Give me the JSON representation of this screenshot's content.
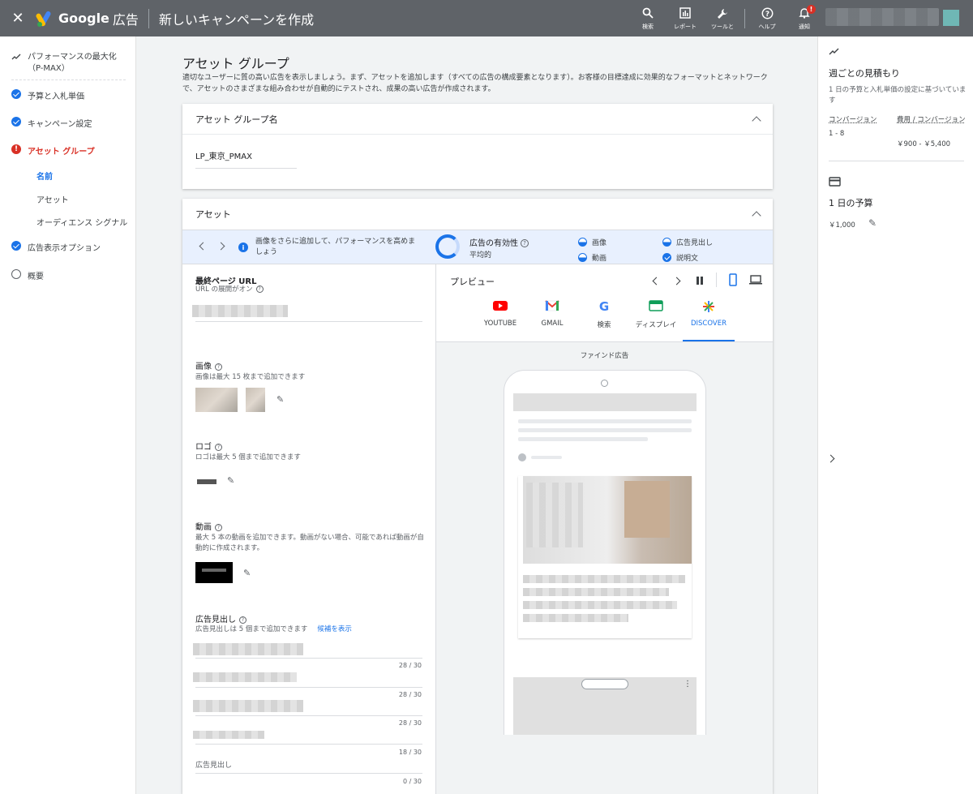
{
  "topbar": {
    "brand_google": "Google",
    "brand_product": "広告",
    "title": "新しいキャンペーンを作成",
    "actions": [
      {
        "label": "検索",
        "icon": "search-icon"
      },
      {
        "label": "レポート",
        "icon": "reports-icon"
      },
      {
        "label": "ツールと設定",
        "icon": "wrench-icon"
      },
      {
        "label": "ヘルプ",
        "icon": "help-icon"
      },
      {
        "label": "通知",
        "icon": "bell-icon"
      }
    ],
    "notification_count": "!"
  },
  "leftnav": {
    "items": [
      {
        "label": "パフォーマンスの最大化（P-MAX）",
        "status": "trend"
      },
      {
        "label": "予算と入札単価",
        "status": "done"
      },
      {
        "label": "キャンペーン設定",
        "status": "done"
      },
      {
        "label": "アセット グループ",
        "status": "error"
      },
      {
        "label": "広告表示オプション",
        "status": "done"
      },
      {
        "label": "概要",
        "status": "empty"
      }
    ],
    "subitems": [
      "名前",
      "アセット",
      "オーディエンス シグナル"
    ]
  },
  "main": {
    "title": "アセット グループ",
    "description": "適切なユーザーに質の高い広告を表示しましょう。まず、アセットを追加します（すべての広告の構成要素となります）。お客様の目標達成に効果的なフォーマットとネットワークで、アセットのさまざまな組み合わせが自動的にテストされ、成果の高い広告が作成されます。",
    "group_name_card": {
      "header": "アセット グループ名",
      "value": "LP_東京_PMAX"
    },
    "assets_card": {
      "header": "アセット",
      "strength": {
        "message": "画像をさらに追加して、パフォーマンスを高めましょう",
        "label": "広告の有効性",
        "level": "平均的",
        "chips": [
          "画像",
          "広告見出し",
          "動画",
          "説明文"
        ]
      },
      "final_url": {
        "label": "最終ページ URL",
        "sub": "URL の展開がオン"
      },
      "images": {
        "label": "画像",
        "sub": "画像は最大 15 枚まで追加できます"
      },
      "logo": {
        "label": "ロゴ",
        "sub": "ロゴは最大 5 個まで追加できます"
      },
      "video": {
        "label": "動画",
        "sub": "最大 5 本の動画を追加できます。動画がない場合、可能であれば動画が自動的に作成されます。"
      },
      "headlines": {
        "label": "広告見出し",
        "sub": "広告見出しは 5 個まで追加できます",
        "suggest": "候補を表示",
        "counters": [
          "28 / 30",
          "28 / 30",
          "28 / 30",
          "18 / 30",
          "0 / 30"
        ],
        "placeholder": "広告見出し"
      }
    },
    "preview": {
      "title": "プレビュー",
      "tabs": [
        "YOUTUBE",
        "GMAIL",
        "検索",
        "ディスプレイ",
        "DISCOVER"
      ],
      "active_tab": "DISCOVER",
      "label": "ファインド広告"
    }
  },
  "rightsidebar": {
    "weekly_title": "週ごとの見積もり",
    "weekly_desc": "1 日の予算と入札単価の設定に基づいています",
    "conv_label": "コンバージョン",
    "conv_value": "1 - 8",
    "cpa_label": "費用 / コンバージョン",
    "cpa_value": "￥900 - ￥5,400",
    "budget_title": "1 日の予算",
    "budget_value": "￥1,000"
  },
  "colors": {
    "accent": "#1a73e8",
    "error": "#d93025",
    "topbar": "#5f6368"
  }
}
